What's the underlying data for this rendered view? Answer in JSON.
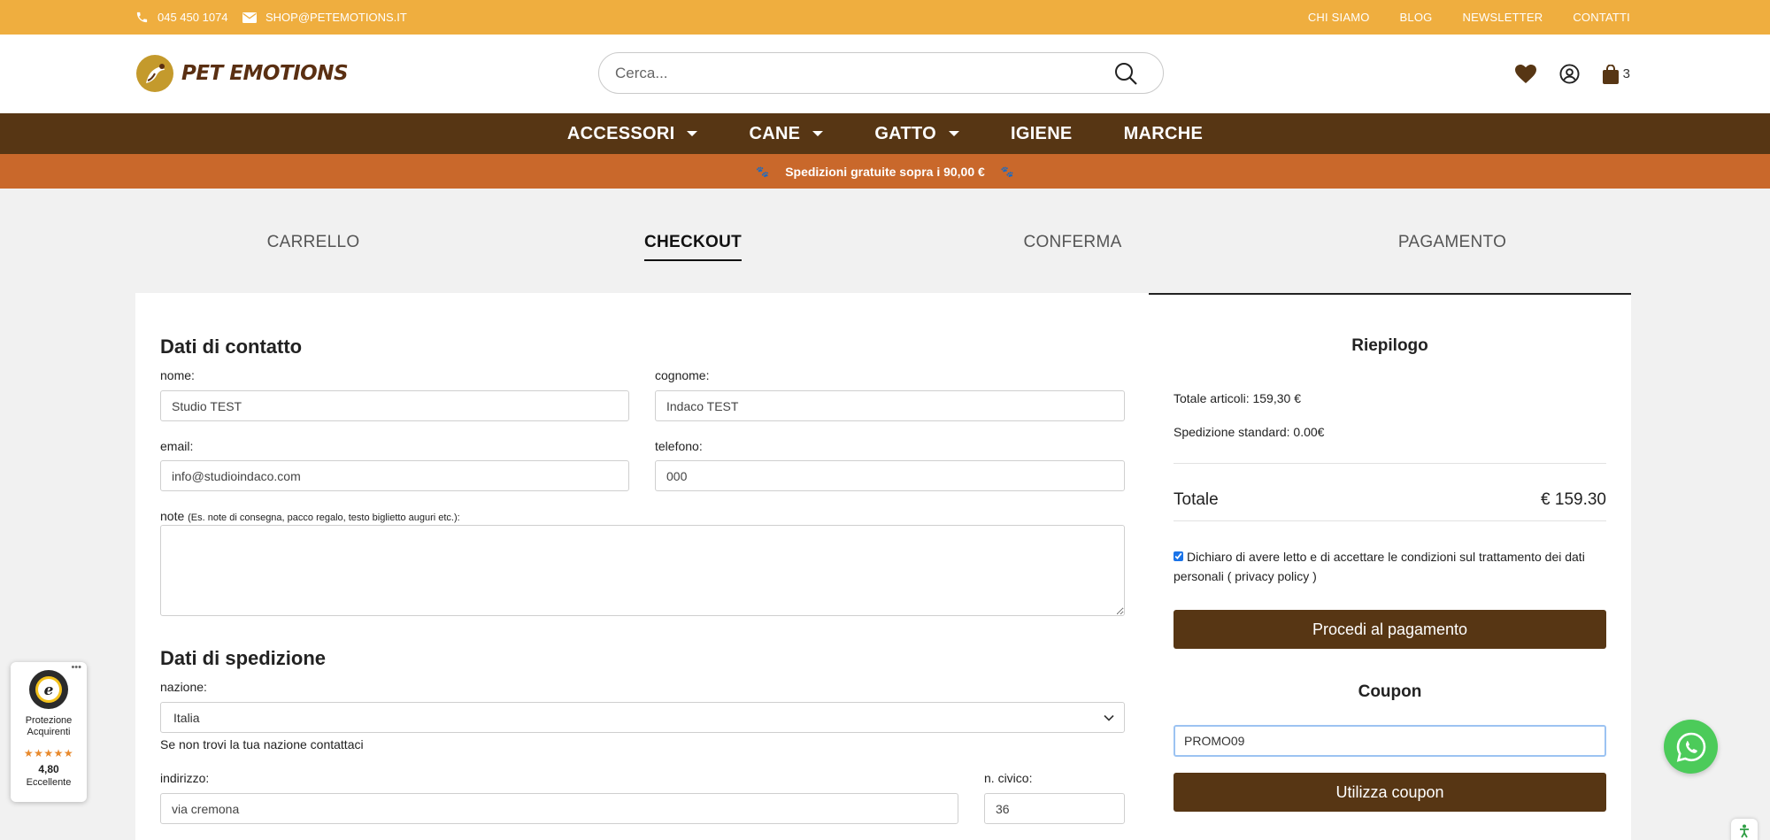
{
  "topbar": {
    "phone": "045 450 1074",
    "email": "SHOP@PETEMOTIONS.IT",
    "links": [
      "CHI SIAMO",
      "BLOG",
      "NEWSLETTER",
      "CONTATTI"
    ]
  },
  "header": {
    "logo_text": "PET EMOTIONS",
    "search_placeholder": "Cerca...",
    "cart_count": "3",
    "icons": [
      "heart-icon",
      "user-icon",
      "bag-icon"
    ]
  },
  "nav": {
    "items": [
      {
        "label": "ACCESSORI",
        "dropdown": true
      },
      {
        "label": "CANE",
        "dropdown": true
      },
      {
        "label": "GATTO",
        "dropdown": true
      },
      {
        "label": "IGIENE",
        "dropdown": false
      },
      {
        "label": "MARCHE",
        "dropdown": false
      }
    ]
  },
  "promo": {
    "text": "Spedizioni gratuite sopra i 90,00 €"
  },
  "steps": {
    "items": [
      "CARRELLO",
      "CHECKOUT",
      "CONFERMA",
      "PAGAMENTO"
    ],
    "active": "CHECKOUT"
  },
  "contact": {
    "title": "Dati di contatto",
    "nome_label": "nome:",
    "nome_value": "Studio TEST",
    "cognome_label": "cognome:",
    "cognome_value": "Indaco TEST",
    "email_label": "email:",
    "email_value": "info@studioindaco.com",
    "telefono_label": "telefono:",
    "telefono_value": "000",
    "note_label": "note",
    "note_hint": "(Es. note di consegna, pacco regalo, testo biglietto auguri etc.):",
    "note_value": ""
  },
  "shipping": {
    "title": "Dati di spedizione",
    "nazione_label": "nazione:",
    "nazione_value": "Italia",
    "nazione_hint": "Se non trovi la tua nazione contattaci",
    "indirizzo_label": "indirizzo:",
    "indirizzo_value": "via cremona",
    "civico_label": "n. civico:",
    "civico_value": "36"
  },
  "summary": {
    "title": "Riepilogo",
    "totale_articoli": "Totale articoli: 159,30 €",
    "spedizione": "Spedizione standard: 0.00€",
    "totale_label": "Totale",
    "totale_value": "€ 159.30",
    "privacy_text": "Dichiaro di avere letto e di accettare le condizioni sul trattamento dei dati personali ( privacy policy )",
    "privacy_checked": true,
    "proceed_label": "Procedi al pagamento",
    "coupon_title": "Coupon",
    "coupon_value": "PROMO09",
    "coupon_button": "Utilizza coupon"
  },
  "trusted": {
    "label": "Protezione Acquirenti",
    "stars": "★★★★★",
    "score": "4,80",
    "rating_word": "Eccellente"
  },
  "colors": {
    "topbar": "#efae3f",
    "nav": "#573614",
    "promo": "#c9682b",
    "button": "#573614",
    "whatsapp": "#4ccb5a"
  }
}
